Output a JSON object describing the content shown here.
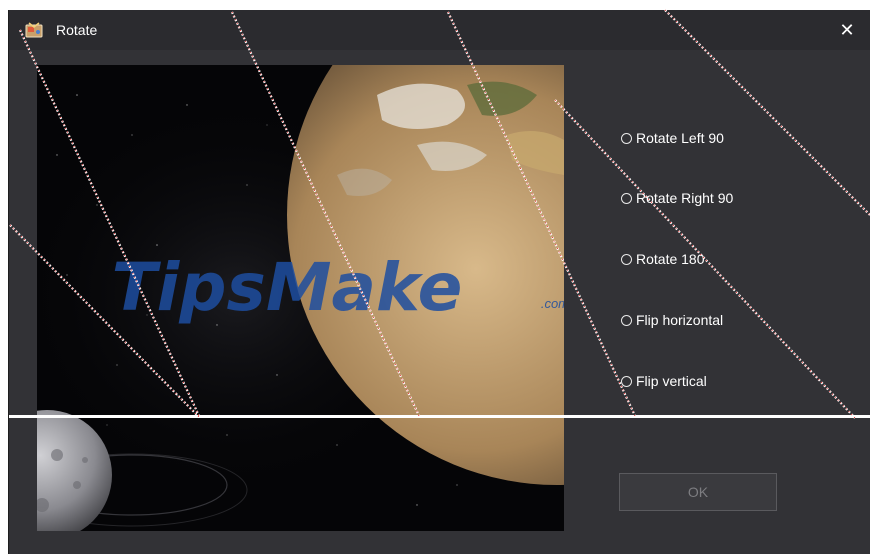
{
  "window": {
    "title": "Rotate",
    "close_label": "✕"
  },
  "preview": {
    "watermark_main": "TipsMake",
    "watermark_suffix": ".com"
  },
  "options": [
    {
      "label": "Rotate Left 90",
      "selected": false
    },
    {
      "label": "Rotate Right 90",
      "selected": false
    },
    {
      "label": "Rotate 180",
      "selected": false
    },
    {
      "label": "Flip horizontal",
      "selected": false
    },
    {
      "label": "Flip vertical",
      "selected": false
    }
  ],
  "ok_button": {
    "label": "OK",
    "enabled": false
  },
  "colors": {
    "dialog_bg": "#323236",
    "titlebar_bg": "#2b2b2f",
    "text": "#ffffff",
    "disabled_text": "#7d7d81",
    "watermark": "#1d4ea0"
  }
}
